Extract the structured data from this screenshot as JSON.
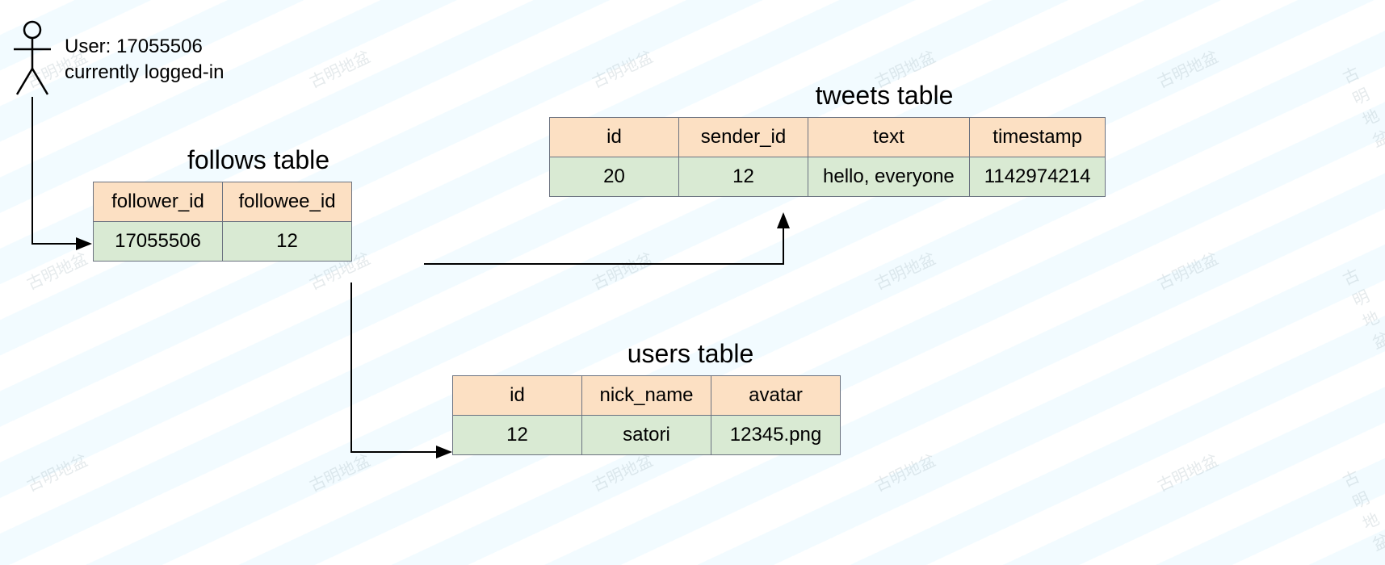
{
  "actor": {
    "line1": "User:  17055506",
    "line2": "currently logged-in"
  },
  "watermark_text": "古明地盆",
  "tables": {
    "follows": {
      "title": "follows table",
      "headers": [
        "follower_id",
        "followee_id"
      ],
      "row": [
        "17055506",
        "12"
      ]
    },
    "tweets": {
      "title": "tweets table",
      "headers": [
        "id",
        "sender_id",
        "text",
        "timestamp"
      ],
      "row": [
        "20",
        "12",
        "hello, everyone",
        "1142974214"
      ]
    },
    "users": {
      "title": "users table",
      "headers": [
        "id",
        "nick_name",
        "avatar"
      ],
      "row": [
        "12",
        "satori",
        "12345.png"
      ]
    }
  }
}
